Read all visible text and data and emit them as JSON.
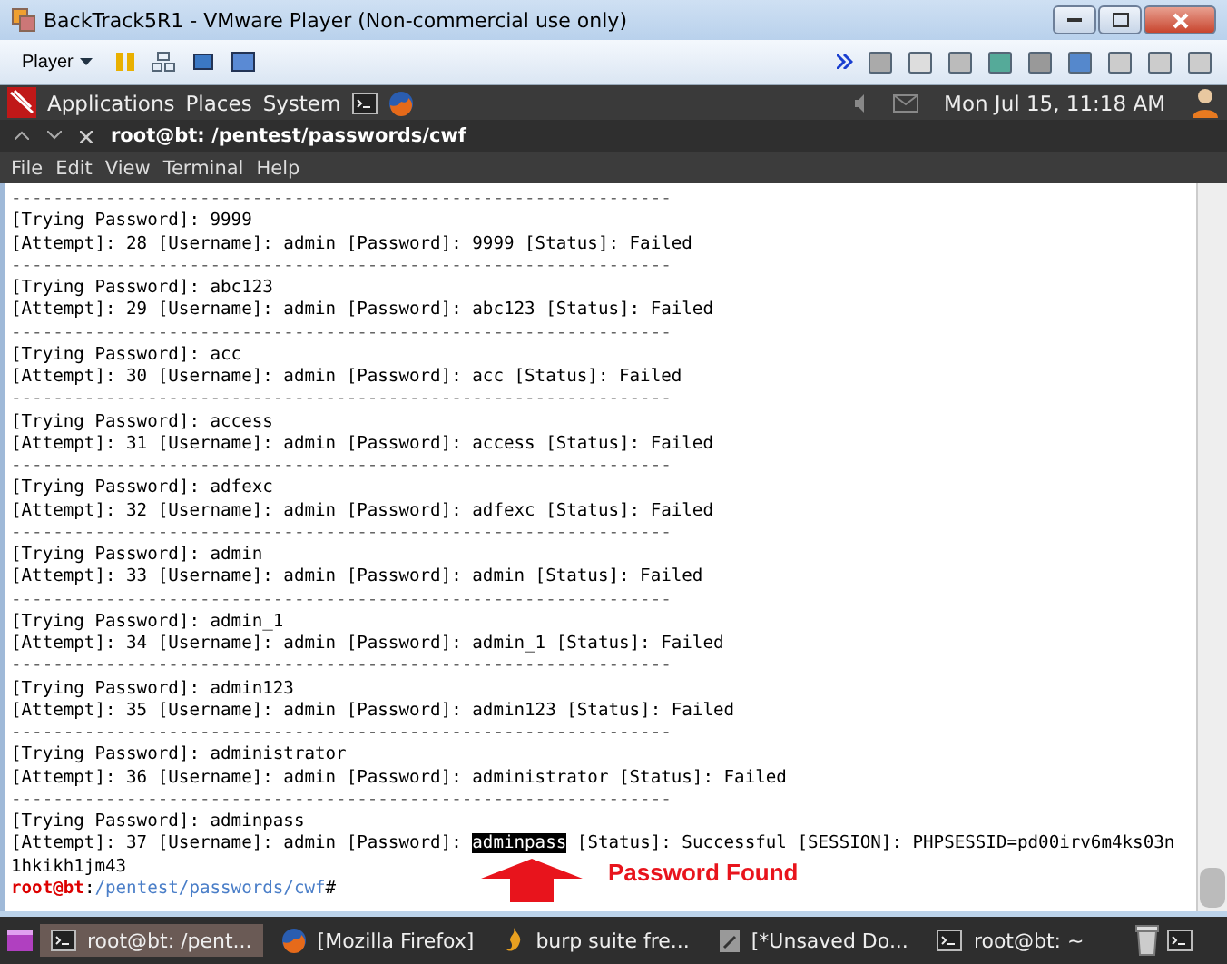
{
  "window": {
    "title": "BackTrack5R1 - VMware Player (Non-commercial use only)"
  },
  "player_toolbar": {
    "menu": "Player"
  },
  "top_panel": {
    "menus": [
      "Applications",
      "Places",
      "System"
    ],
    "clock": "Mon Jul 15, 11:18 AM"
  },
  "terminal": {
    "title": "root@bt: /pentest/passwords/cwf",
    "menu": [
      "File",
      "Edit",
      "View",
      "Terminal",
      "Help"
    ],
    "lines": [
      {
        "kind": "rule",
        "text": "---------------------------------------------------------------"
      },
      {
        "kind": "text",
        "text": "[Trying Password]: 9999"
      },
      {
        "kind": "text",
        "text": "[Attempt]: 28 [Username]: admin [Password]: 9999 [Status]: Failed"
      },
      {
        "kind": "rule",
        "text": "---------------------------------------------------------------"
      },
      {
        "kind": "text",
        "text": "[Trying Password]: abc123"
      },
      {
        "kind": "text",
        "text": "[Attempt]: 29 [Username]: admin [Password]: abc123 [Status]: Failed"
      },
      {
        "kind": "rule",
        "text": "---------------------------------------------------------------"
      },
      {
        "kind": "text",
        "text": "[Trying Password]: acc"
      },
      {
        "kind": "text",
        "text": "[Attempt]: 30 [Username]: admin [Password]: acc [Status]: Failed"
      },
      {
        "kind": "rule",
        "text": "---------------------------------------------------------------"
      },
      {
        "kind": "text",
        "text": "[Trying Password]: access"
      },
      {
        "kind": "text",
        "text": "[Attempt]: 31 [Username]: admin [Password]: access [Status]: Failed"
      },
      {
        "kind": "rule",
        "text": "---------------------------------------------------------------"
      },
      {
        "kind": "text",
        "text": "[Trying Password]: adfexc"
      },
      {
        "kind": "text",
        "text": "[Attempt]: 32 [Username]: admin [Password]: adfexc [Status]: Failed"
      },
      {
        "kind": "rule",
        "text": "---------------------------------------------------------------"
      },
      {
        "kind": "text",
        "text": "[Trying Password]: admin"
      },
      {
        "kind": "text",
        "text": "[Attempt]: 33 [Username]: admin [Password]: admin [Status]: Failed"
      },
      {
        "kind": "rule",
        "text": "---------------------------------------------------------------"
      },
      {
        "kind": "text",
        "text": "[Trying Password]: admin_1"
      },
      {
        "kind": "text",
        "text": "[Attempt]: 34 [Username]: admin [Password]: admin_1 [Status]: Failed"
      },
      {
        "kind": "rule",
        "text": "---------------------------------------------------------------"
      },
      {
        "kind": "text",
        "text": "[Trying Password]: admin123"
      },
      {
        "kind": "text",
        "text": "[Attempt]: 35 [Username]: admin [Password]: admin123 [Status]: Failed"
      },
      {
        "kind": "rule",
        "text": "---------------------------------------------------------------"
      },
      {
        "kind": "text",
        "text": "[Trying Password]: administrator"
      },
      {
        "kind": "text",
        "text": "[Attempt]: 36 [Username]: admin [Password]: administrator [Status]: Failed"
      },
      {
        "kind": "rule",
        "text": "---------------------------------------------------------------"
      },
      {
        "kind": "text",
        "text": "[Trying Password]: adminpass"
      },
      {
        "kind": "highlight",
        "before": "[Attempt]: 37 [Username]: admin [Password]: ",
        "highlight": "adminpass",
        "after": " [Status]: Successful [SESSION]: PHPSESSID=pd00irv6m4ks03n"
      },
      {
        "kind": "text",
        "text": "1hkikh1jm43"
      },
      {
        "kind": "prompt",
        "user": "root@bt",
        "separator": ":",
        "path": "/pentest/passwords/cwf",
        "symbol": "#"
      }
    ]
  },
  "annotation": {
    "text": "Password Found"
  },
  "taskbar": [
    {
      "label": "root@bt: /pent...",
      "selected": true
    },
    {
      "label": "[Mozilla Firefox]",
      "selected": false
    },
    {
      "label": "burp suite fre...",
      "selected": false
    },
    {
      "label": "[*Unsaved Do...",
      "selected": false
    },
    {
      "label": "root@bt: ~",
      "selected": false
    }
  ]
}
